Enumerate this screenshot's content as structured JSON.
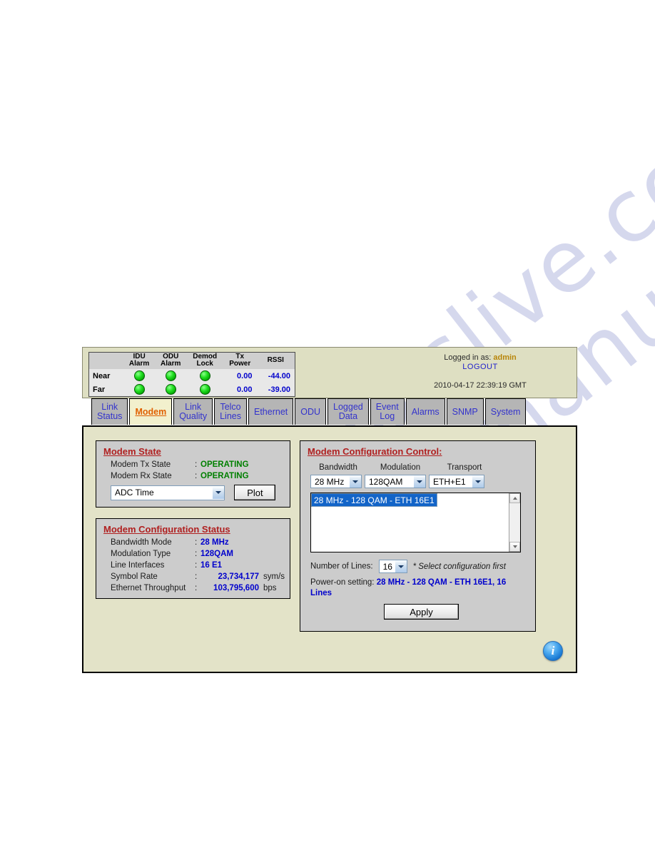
{
  "header": {
    "status_table": {
      "columns": [
        "",
        "IDU\nAlarm",
        "ODU\nAlarm",
        "Demod\nLock",
        "Tx\nPower",
        "RSSI"
      ],
      "rows": [
        {
          "label": "Near",
          "idu_alarm": "ok",
          "odu_alarm": "ok",
          "demod_lock": "ok",
          "tx_power": "0.00",
          "rssi": "-44.00"
        },
        {
          "label": "Far",
          "idu_alarm": "ok",
          "odu_alarm": "ok",
          "demod_lock": "ok",
          "tx_power": "0.00",
          "rssi": "-39.00"
        }
      ]
    },
    "logged_in_prefix": "Logged in as: ",
    "logged_in_user": "admin",
    "logout_label": "LOGOUT",
    "timestamp": "2010-04-17 22:39:19 GMT"
  },
  "tabs": [
    {
      "label": "Link\nStatus",
      "active": false
    },
    {
      "label": "Modem",
      "active": true
    },
    {
      "label": "Link\nQuality",
      "active": false
    },
    {
      "label": "Telco\nLines",
      "active": false
    },
    {
      "label": "Ethernet",
      "active": false
    },
    {
      "label": "ODU",
      "active": false
    },
    {
      "label": "Logged\nData",
      "active": false
    },
    {
      "label": "Event\nLog",
      "active": false
    },
    {
      "label": "Alarms",
      "active": false
    },
    {
      "label": "SNMP",
      "active": false
    },
    {
      "label": "System",
      "active": false
    }
  ],
  "modem_state": {
    "title": "Modem State",
    "tx_label": "Modem Tx State",
    "tx_value": "OPERATING",
    "rx_label": "Modem Rx State",
    "rx_value": "OPERATING",
    "plot_select_value": "ADC Time",
    "plot_button": "Plot"
  },
  "config_status": {
    "title": "Modem Configuration Status",
    "rows": [
      {
        "label": "Bandwidth Mode",
        "value": "28 MHz",
        "unit": ""
      },
      {
        "label": "Modulation Type",
        "value": "128QAM",
        "unit": ""
      },
      {
        "label": "Line Interfaces",
        "value": "16 E1",
        "unit": ""
      },
      {
        "label": "Symbol Rate",
        "value": "23,734,177",
        "unit": "sym/s"
      },
      {
        "label": "Ethernet Throughput",
        "value": "103,795,600",
        "unit": "bps"
      }
    ]
  },
  "config_control": {
    "title": "Modem Configuration Control:",
    "bandwidth_label": "Bandwidth",
    "bandwidth_value": "28 MHz",
    "modulation_label": "Modulation",
    "modulation_value": "128QAM",
    "transport_label": "Transport",
    "transport_value": "ETH+E1",
    "config_list": [
      {
        "text": "28 MHz - 128 QAM - ETH 16E1",
        "selected": true
      }
    ],
    "lines_label": "Number of Lines:",
    "lines_value": "16",
    "lines_hint": "* Select configuration first",
    "poweron_label": "Power-on setting:",
    "poweron_value": "28 MHz - 128 QAM - ETH 16E1, 16 Lines",
    "apply_label": "Apply"
  },
  "info_icon_glyph": "i",
  "watermark_text": "manualslive.com",
  "colors": {
    "page_bg": "#e3e3c8",
    "header_bg": "#dedfc2",
    "panel_bg": "#cccccc",
    "tab_bg": "#b5b5b5",
    "tab_active_bg": "#f2f0cd",
    "tab_text": "#3333cc",
    "tab_active_text": "#e06000",
    "title_red": "#b02020",
    "value_blue": "#0000cc",
    "value_green": "#008000",
    "led_green": "#23e023",
    "select_blue": "#1264c8"
  }
}
